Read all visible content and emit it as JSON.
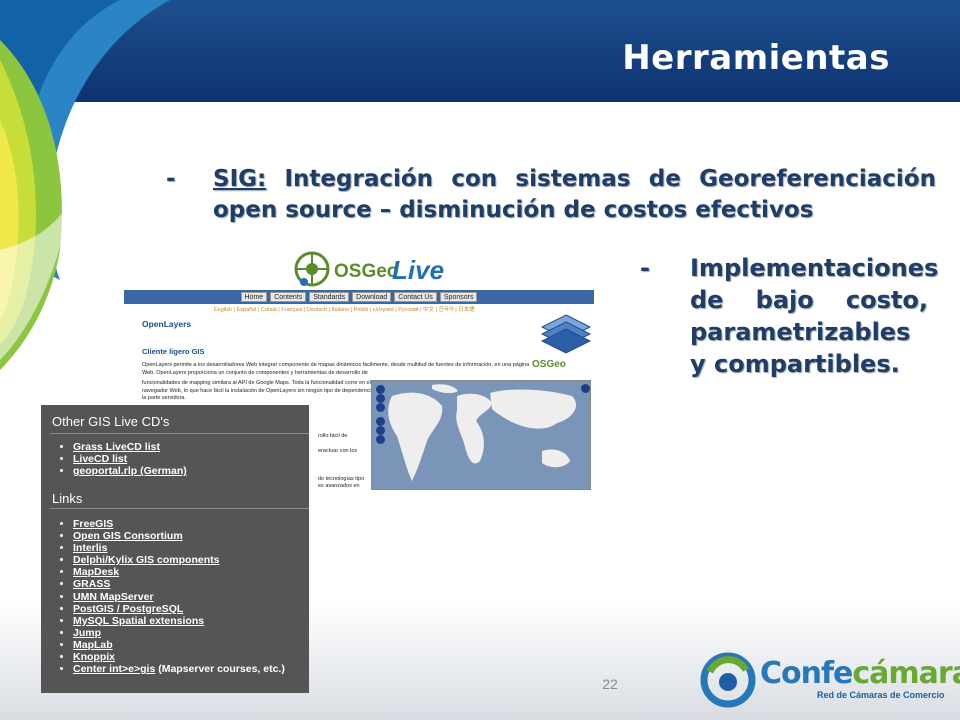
{
  "slide": {
    "title": "Herramientas",
    "page_number": "22"
  },
  "bullets": {
    "item1": {
      "dash": "-",
      "keyword": "SIG:",
      "text": " Integración con sistemas de Georeferenciación open source – disminución de costos efectivos"
    },
    "item2": {
      "dash": "-",
      "text": "Implementaciones de bajo costo, parametrizables y compartibles."
    }
  },
  "osgeo_screenshot": {
    "logo_text_1": "OSGeo",
    "logo_text_2": "Live",
    "nav": [
      "Home",
      "Contents",
      "Standards",
      "Download",
      "Contact Us",
      "Sponsors"
    ],
    "languages": "English | Español | Català | Français | Deutsch | Italiano | Polski | ελληνικά | Русский | 中文 | 한국어 | 日本語",
    "title": "OpenLayers",
    "subtitle": "Cliente ligero GIS",
    "paragraph_1": "OpenLayers permite a los desarrolladores Web integrar componente de mapas dinámicos fácilmente, desde multitud de fuentes de información, en una página Web. OpenLayers proporciona un conjunto de componentes y herramientas de desarrollo de",
    "paragraph_2": "funcionalidades de mapping similara al API de Google Maps. Toda la funcionalidad corre en el navegador Web, lo que hace fácil la instalación de OpenLayers sin ningún tipo de dependencia de la parte servidora.",
    "fragments": [
      "rollo fácil de",
      "eractuar con los",
      "do tecnologías tipo",
      "es avanzados en"
    ],
    "small_logo": "OSGeo"
  },
  "panel": {
    "heading_1": "Other GIS Live CD's",
    "list_1": [
      "Grass LiveCD list",
      "LiveCD list",
      "geoportal.rlp (German)"
    ],
    "heading_2": "Links",
    "list_2": [
      "FreeGIS",
      "Open GIS Consortium",
      "Interlis",
      "Delphi/Kylix GIS components",
      "MapDesk",
      "GRASS",
      "UMN MapServer",
      "PostGIS / PostgreSQL",
      "MySQL Spatial extensions",
      "Jump",
      "MapLab",
      "Knoppix",
      "Center int>e>gis"
    ],
    "last_item_suffix": " (Mapserver courses, etc.)"
  },
  "brand": {
    "name_part_1": "Confe",
    "name_part_2": "cámaras",
    "tagline": "Red de Cámaras de Comercio",
    "colors": {
      "blue": "#2678b8",
      "green": "#6aa834",
      "navy": "#1f3d66"
    }
  }
}
